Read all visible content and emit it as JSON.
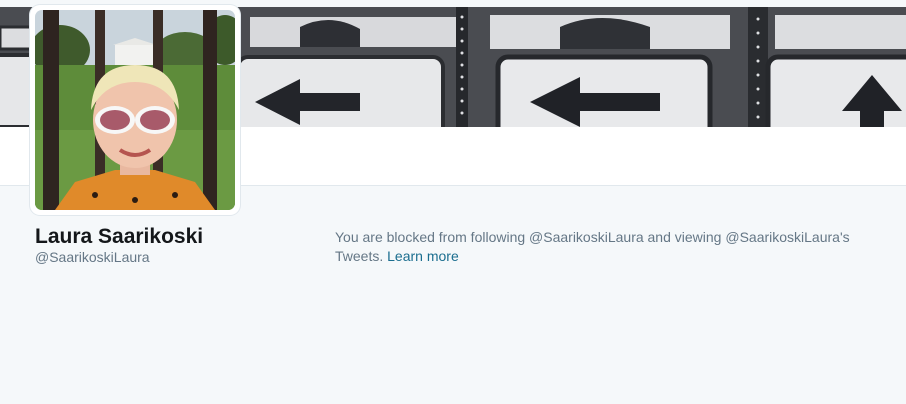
{
  "profile": {
    "name": "Laura Saarikoski",
    "handle": "@SaarikoskiLaura"
  },
  "blocked_notice": {
    "line": "You are blocked from following @SaarikoskiLaura and viewing @SaarikoskiLaura's Tweets.",
    "learn_more": "Learn more"
  },
  "colors": {
    "page_background": "#f5f8fa",
    "link": "#1b6e8f",
    "muted_text": "#657786"
  }
}
